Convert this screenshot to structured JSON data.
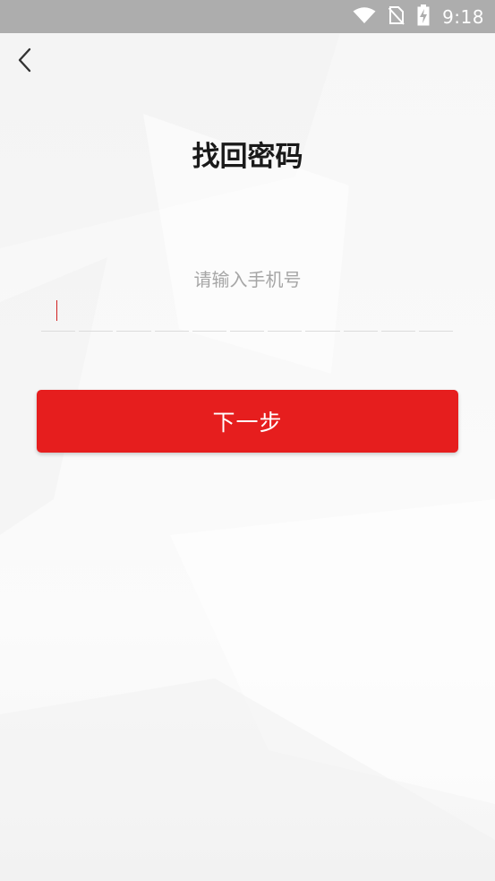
{
  "status_bar": {
    "time": "9:18",
    "icons": [
      "wifi-icon",
      "no-sim-icon",
      "battery-charging-icon"
    ],
    "background_color": "#adadad"
  },
  "header": {
    "back_icon": "chevron-left-icon"
  },
  "page": {
    "title": "找回密码",
    "phone_label": "请输入手机号",
    "digit_count": 11,
    "phone_value": ""
  },
  "actions": {
    "next_label": "下一步"
  },
  "colors": {
    "accent": "#e61e1e",
    "title": "#1a1a1a",
    "hint": "#a6a6a6",
    "cursor": "#d12020"
  }
}
